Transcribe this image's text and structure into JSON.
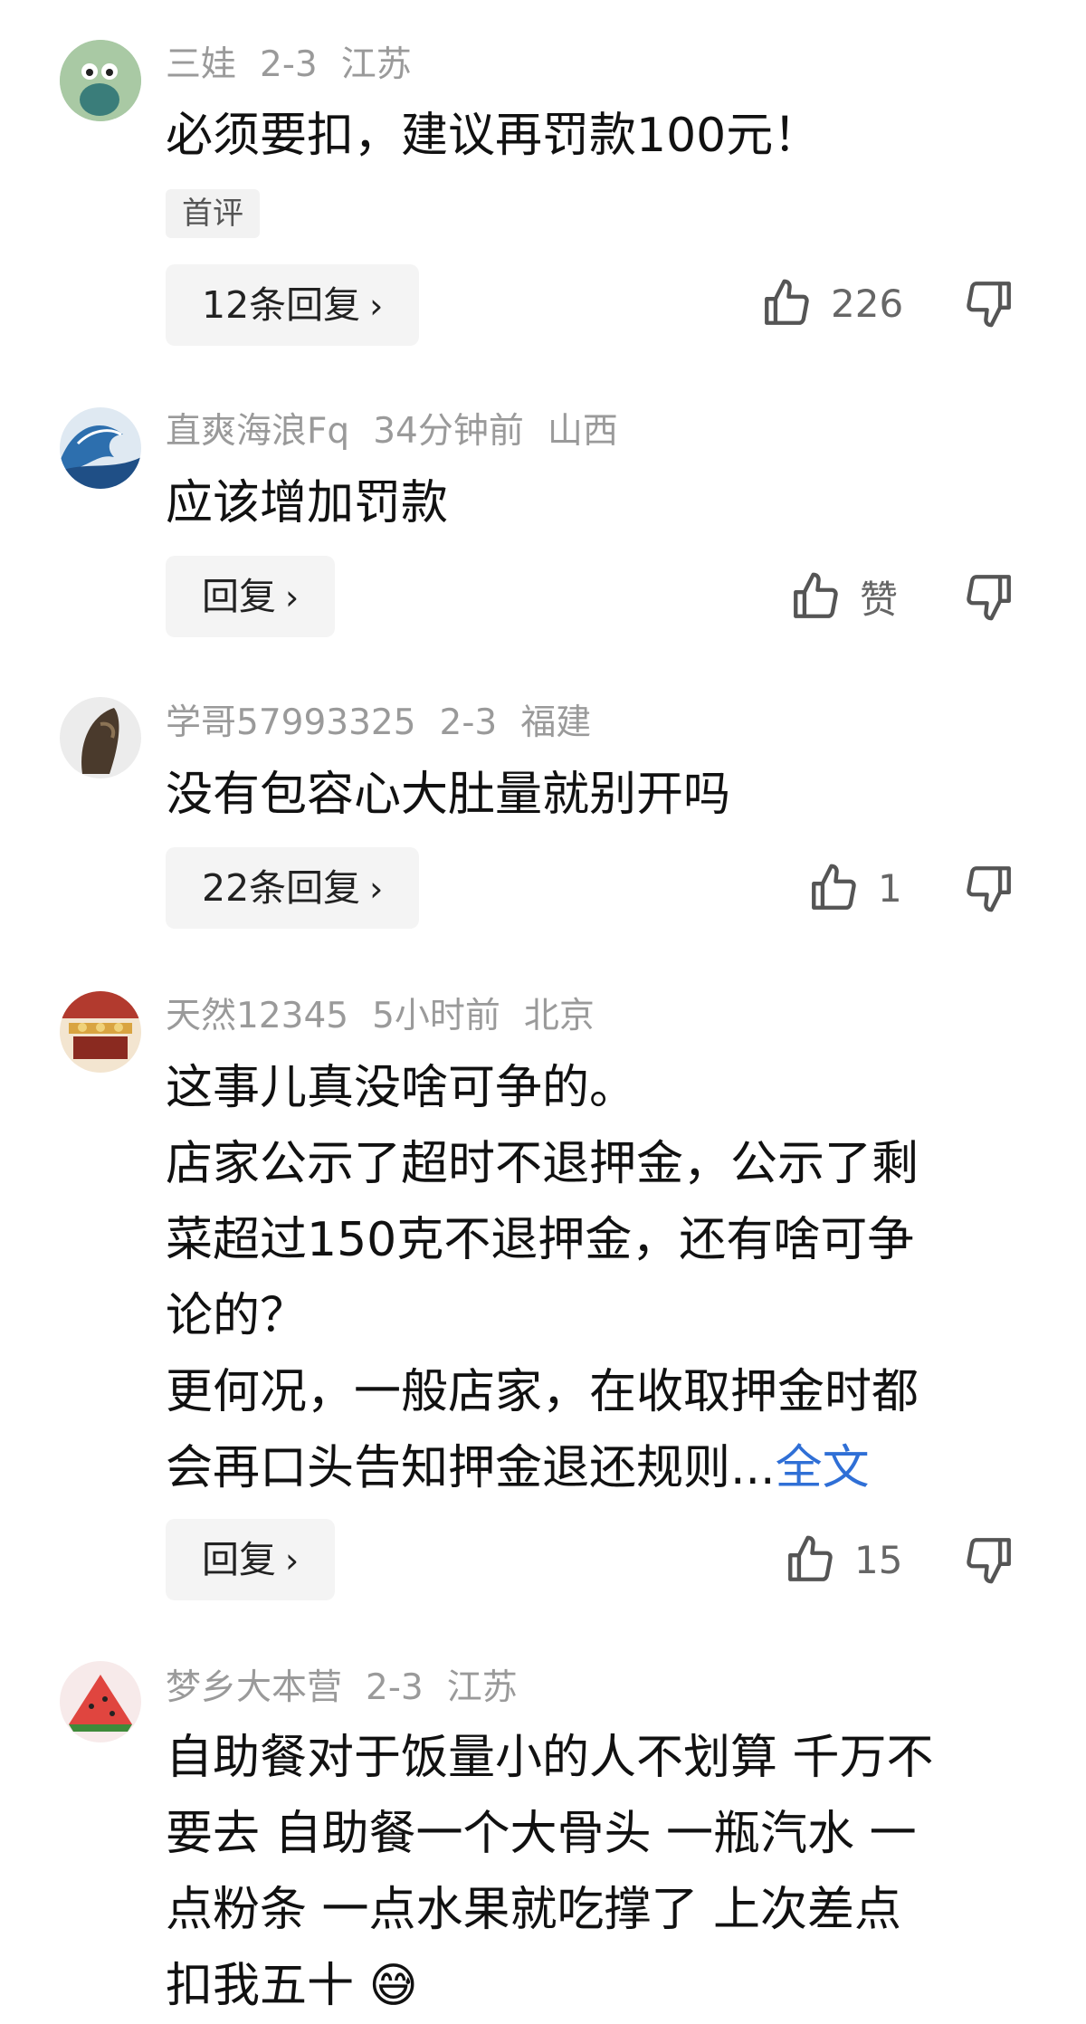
{
  "comments": [
    {
      "username": "三娃",
      "time": "2-3",
      "location": "江苏",
      "lines": [
        "必须要扣，建议再罚款100元！"
      ],
      "badge": "首评",
      "reply_label": "12条回复",
      "likes": "226",
      "avatar_color": "#a8c7a6"
    },
    {
      "username": "直爽海浪Fq",
      "time": "34分钟前",
      "location": "山西",
      "lines": [
        "应该增加罚款"
      ],
      "reply_label": "回复",
      "likes": "赞",
      "avatar_color": "#3b7bb8"
    },
    {
      "username": "学哥57993325",
      "time": "2-3",
      "location": "福建",
      "lines": [
        "没有包容心大肚量就别开吗"
      ],
      "reply_label": "22条回复",
      "likes": "1",
      "avatar_color": "#6e5a47"
    },
    {
      "username": "天然12345",
      "time": "5小时前",
      "location": "北京",
      "lines": [
        "这事儿真没啥可争的。",
        "店家公示了超时不退押金，公示了剩",
        "菜超过150克不退押金，还有啥可争",
        "论的？",
        "更何况，一般店家，在收取押金时都",
        "会再口头告知押金退还规则..."
      ],
      "full_text_link": "全文",
      "reply_label": "回复",
      "likes": "15",
      "avatar_color": "#b23a2e"
    },
    {
      "username": "梦乡大本营",
      "time": "2-3",
      "location": "江苏",
      "lines": [
        "自助餐对于饭量小的人不划算 千万不",
        "要去 自助餐一个大骨头 一瓶汽水 一",
        "点粉条 一点水果就吃撑了 上次差点",
        "扣我五十 😅"
      ],
      "avatar_color": "#e0453f"
    }
  ]
}
